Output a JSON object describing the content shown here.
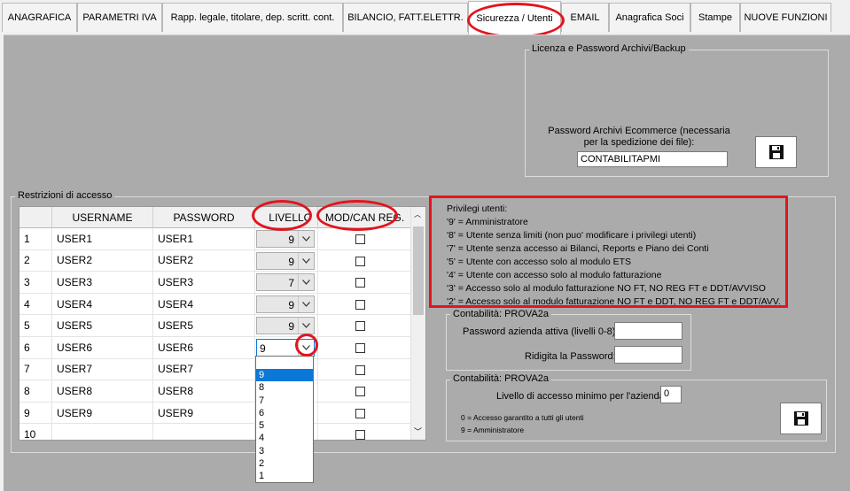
{
  "tabs": [
    "ANAGRAFICA",
    "PARAMETRI IVA",
    "Rapp. legale, titolare, dep. scritt. cont.",
    "BILANCIO, FATT.ELETTR.",
    "Sicurezza / Utenti",
    "EMAIL",
    "Anagrafica Soci",
    "Stampe",
    "NUOVE FUNZIONI"
  ],
  "active_tab": "Sicurezza / Utenti",
  "licenza": {
    "group_title": "Licenza e Password Archivi/Backup",
    "label": "Password Archivi Ecommerce (necessaria per la spedizione dei file):",
    "value": "CONTABILITAPMI",
    "save_icon": "floppy-disk-icon"
  },
  "restrizioni": {
    "group_title": "Restrizioni di accesso",
    "columns": [
      "",
      "USERNAME",
      "PASSWORD",
      "LIVELLO",
      "MOD/CAN REG."
    ],
    "rows": [
      {
        "n": "1",
        "user": "USER1",
        "pass": "USER1",
        "level": "9"
      },
      {
        "n": "2",
        "user": "USER2",
        "pass": "USER2",
        "level": "9"
      },
      {
        "n": "3",
        "user": "USER3",
        "pass": "USER3",
        "level": "7"
      },
      {
        "n": "4",
        "user": "USER4",
        "pass": "USER4",
        "level": "9"
      },
      {
        "n": "5",
        "user": "USER5",
        "pass": "USER5",
        "level": "9"
      },
      {
        "n": "6",
        "user": "USER6",
        "pass": "USER6",
        "level": "9"
      },
      {
        "n": "7",
        "user": "USER7",
        "pass": "USER7",
        "level": ""
      },
      {
        "n": "8",
        "user": "USER8",
        "pass": "USER8",
        "level": ""
      },
      {
        "n": "9",
        "user": "USER9",
        "pass": "USER9",
        "level": ""
      },
      {
        "n": "10",
        "user": "",
        "pass": "",
        "level": ""
      }
    ],
    "dropdown_options": [
      "9",
      "8",
      "7",
      "6",
      "5",
      "4",
      "3",
      "2",
      "1"
    ],
    "dropdown_selected": "9"
  },
  "privilegi": {
    "title": "Privilegi utenti:",
    "lines": [
      "'9' = Amministratore",
      "'8' = Utente senza limiti (non puo' modificare i privilegi utenti)",
      "'7' = Utente senza accesso ai Bilanci,  Reports e Piano dei Conti",
      "'5' = Utente con accesso solo al modulo ETS",
      "'4' = Utente con accesso solo al modulo fatturazione",
      "'3' = Accesso solo al modulo fatturazione NO FT, NO REG FT e DDT/AVVISO",
      "'2' = Accesso solo al modulo fatturazione NO FT e DDT, NO REG FT e DDT/AVV."
    ]
  },
  "contabilita1": {
    "group_title": "Contabilità:  PROVA2a",
    "password_label": "Password azienda attiva (livelli 0-8):",
    "password_value": "",
    "repeat_label": "Ridigita la Password:",
    "repeat_value": ""
  },
  "contabilita2": {
    "group_title": "Contabilità:  PROVA2a",
    "level_label": "Livello di accesso minimo per l'azienda:",
    "level_value": "0",
    "note1": "0 = Accesso garantito a tutti gli utenti",
    "note2": "9 = Amministratore",
    "save_icon": "floppy-disk-icon"
  }
}
